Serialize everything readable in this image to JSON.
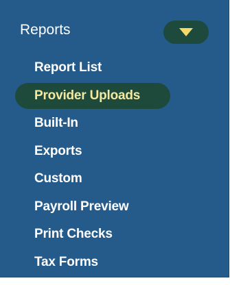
{
  "colors": {
    "panel_bg": "#255b8a",
    "active_pill": "#1e4a3c",
    "active_text": "#f5e9a0",
    "text": "#ffffff",
    "caret": "#f5d96b"
  },
  "header": {
    "title": "Reports",
    "toggle_icon": "caret-down-icon"
  },
  "menu": {
    "items": [
      {
        "label": "Report List",
        "active": false
      },
      {
        "label": "Provider Uploads",
        "active": true
      },
      {
        "label": "Built-In",
        "active": false
      },
      {
        "label": "Exports",
        "active": false
      },
      {
        "label": "Custom",
        "active": false
      },
      {
        "label": "Payroll Preview",
        "active": false
      },
      {
        "label": "Print Checks",
        "active": false
      },
      {
        "label": "Tax Forms",
        "active": false
      }
    ]
  }
}
